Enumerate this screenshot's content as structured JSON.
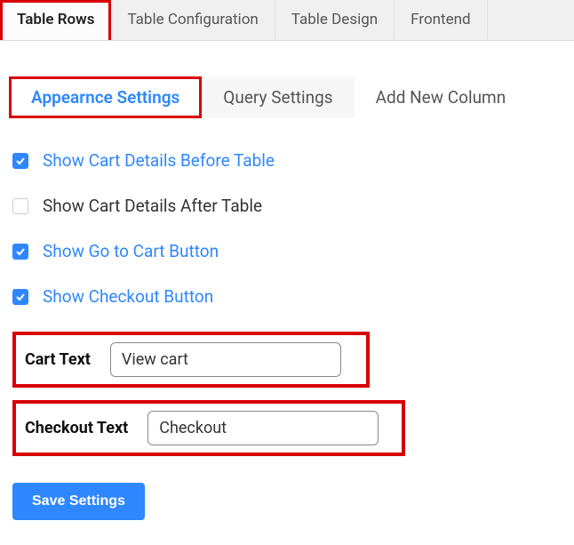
{
  "topTabs": {
    "active": "Table Rows",
    "items": [
      "Table Rows",
      "Table Configuration",
      "Table Design",
      "Frontend"
    ]
  },
  "subTabs": {
    "active": "Appearnce Settings",
    "items": [
      "Appearnce Settings",
      "Query Settings",
      "Add New Column"
    ]
  },
  "options": {
    "showCartBefore": {
      "label": "Show Cart Details Before Table",
      "checked": true
    },
    "showCartAfter": {
      "label": "Show Cart Details After Table",
      "checked": false
    },
    "showGoToCart": {
      "label": "Show Go to Cart Button",
      "checked": true
    },
    "showCheckout": {
      "label": "Show Checkout Button",
      "checked": true
    }
  },
  "fields": {
    "cartText": {
      "label": "Cart Text",
      "value": "View cart"
    },
    "checkoutText": {
      "label": "Checkout Text",
      "value": "Checkout"
    }
  },
  "buttons": {
    "save": "Save Settings"
  }
}
